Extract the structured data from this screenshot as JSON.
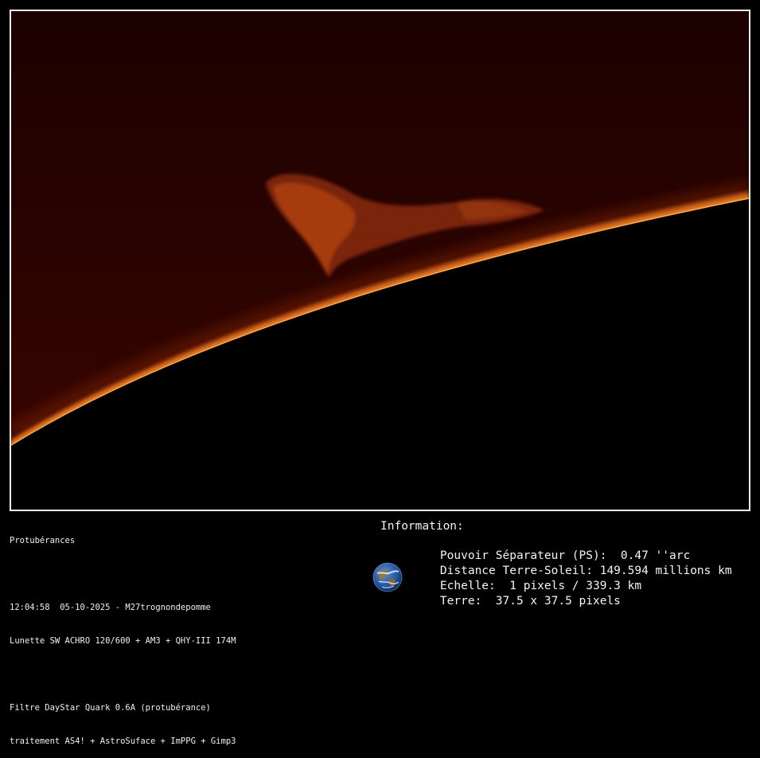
{
  "caption": {
    "title": "Protubérances",
    "capture_line": "12:04:58  05-10-2025 - M27trognondepomme",
    "equipment_line": "Lunette SW ACHRO 120/600 + AM3 + QHY-III 174M",
    "filter_line": "Filtre DayStar Quark 0.6A (protubérance)",
    "processing_line": "traitement AS4! + AstroSuface + ImPPG + Gimp3"
  },
  "info": {
    "heading": "Information:",
    "rows": [
      {
        "label": "Pouvoir Séparateur (PS):",
        "value": "0.47 ''arc"
      },
      {
        "label": "Distance Terre-Soleil:",
        "value": "149.594 millions km"
      },
      {
        "label": "Echelle:",
        "value": "1 pixels / 339.3 km"
      },
      {
        "label": "Terre:",
        "value": "37.5 x 37.5 pixels"
      }
    ]
  },
  "colors": {
    "background": "#000000",
    "frame": "#f2f2f2",
    "sky_glow": "#2a0300",
    "chromosphere": "#e8761a",
    "prominence": "#b8470f"
  },
  "icons": {
    "earth": "earth-globe-icon"
  }
}
